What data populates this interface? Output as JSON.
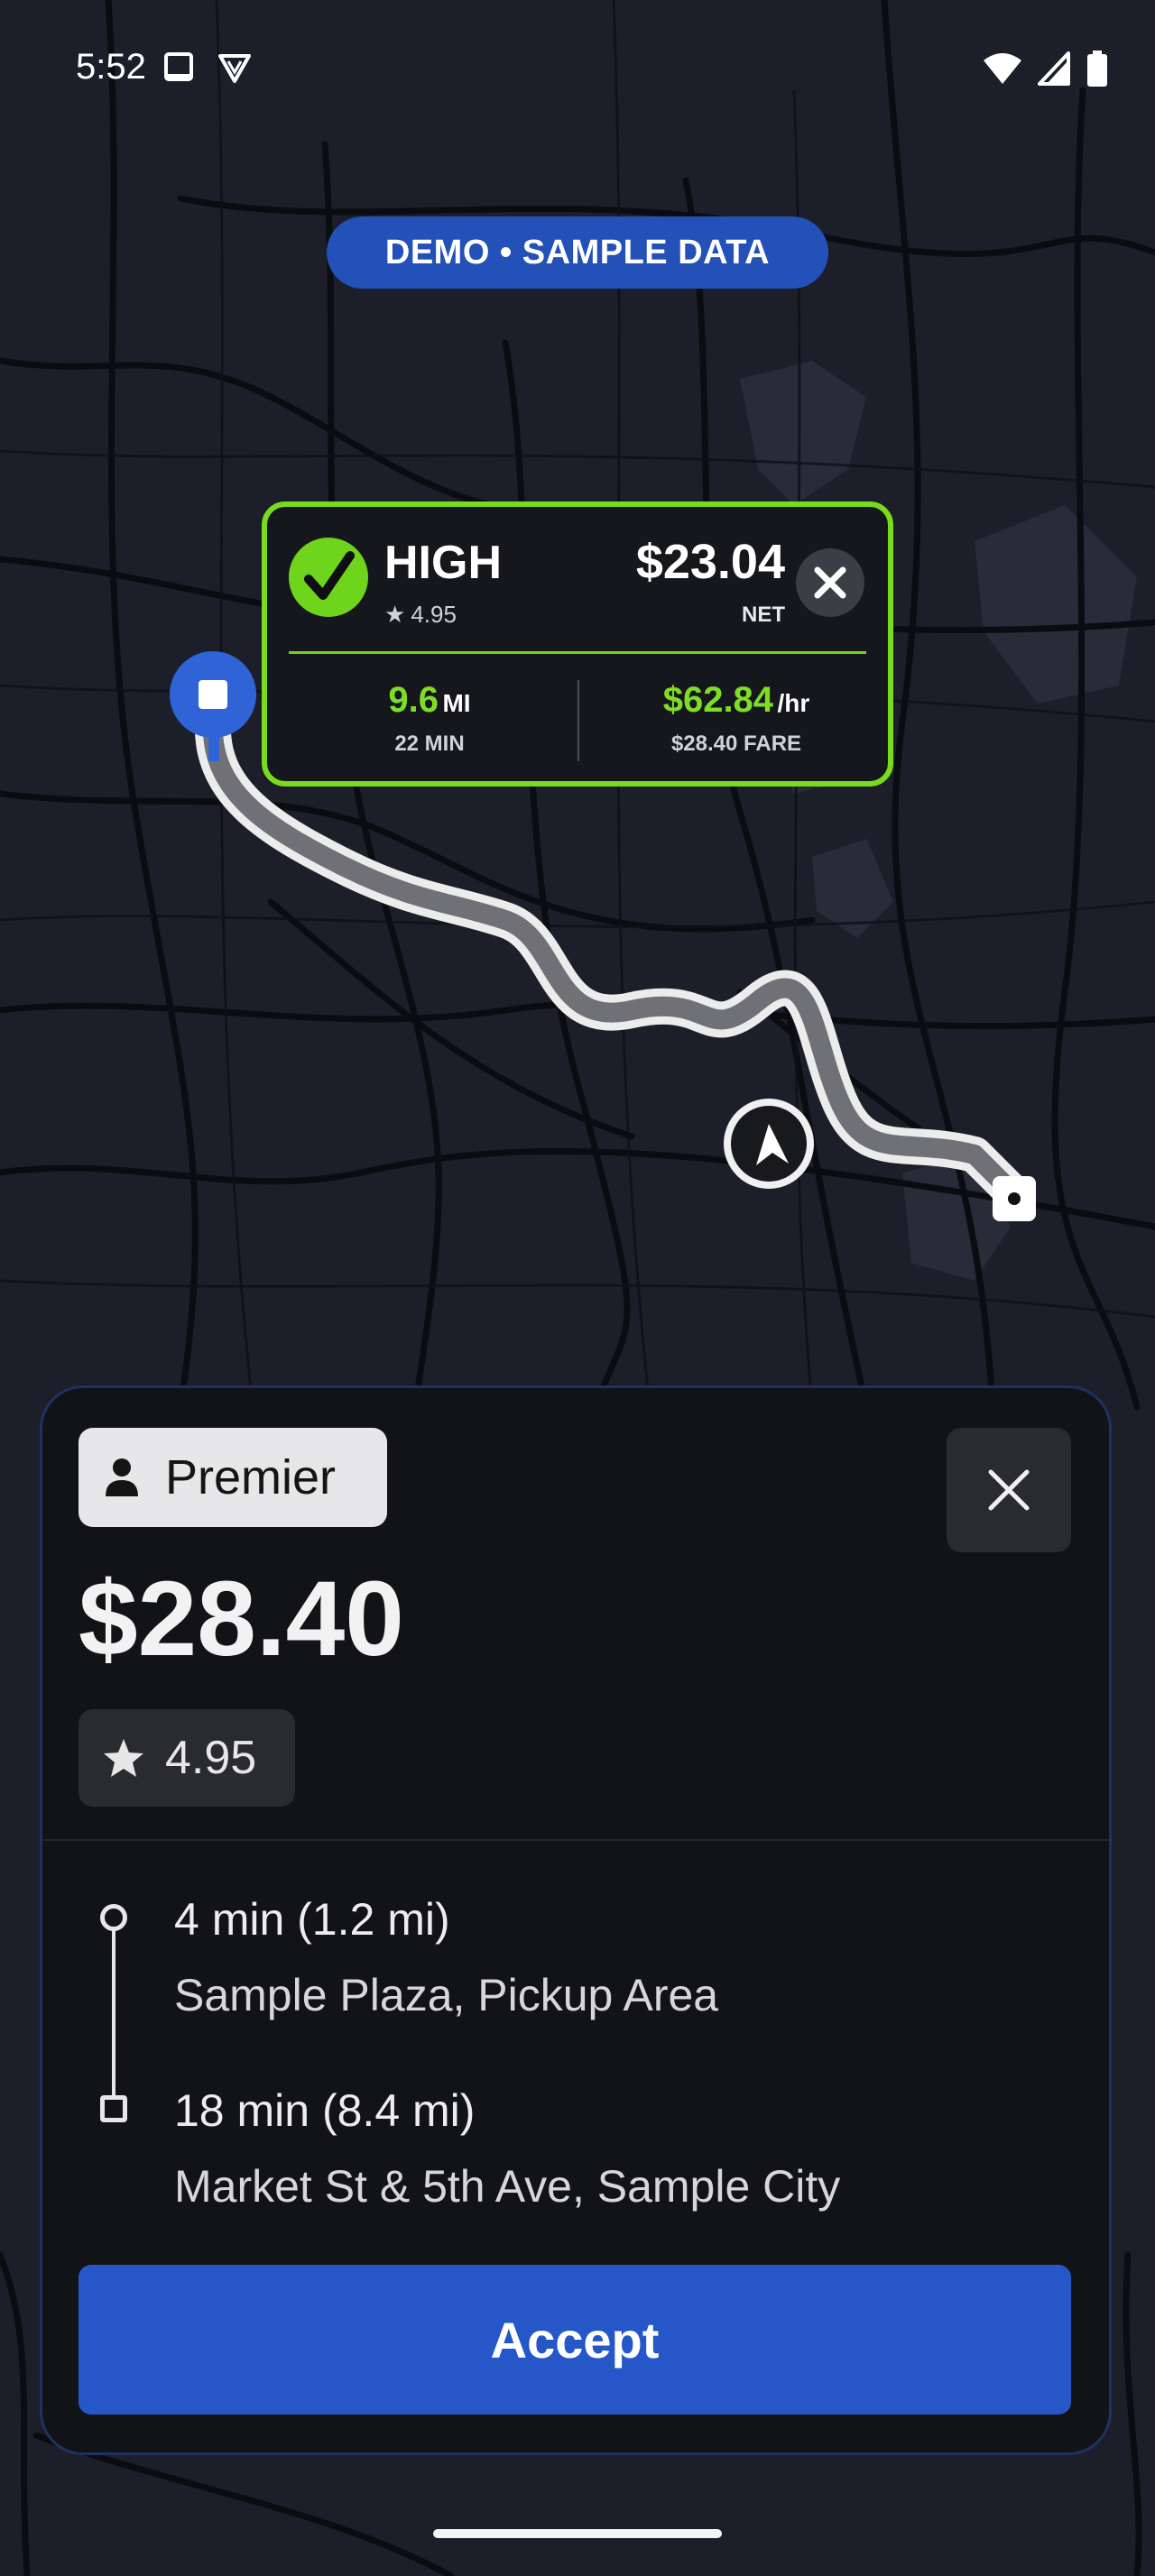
{
  "status_bar": {
    "time": "5:52",
    "left_icons": [
      "screen-icon",
      "shield-v-icon"
    ],
    "right_icons": [
      "wifi-icon",
      "signal-icon",
      "battery-icon"
    ]
  },
  "demo_badge": "DEMO • SAMPLE DATA",
  "overlay": {
    "rating_label": "HIGH",
    "rider_rating": "4.95",
    "net_amount": "$23.04",
    "net_label": "NET",
    "distance_value": "9.6",
    "distance_unit": "MI",
    "duration": "22 MIN",
    "hourly_value": "$62.84",
    "hourly_unit": "/hr",
    "fare_caption": "$28.40 FARE",
    "accent_color": "#78dc1c"
  },
  "map": {
    "pickup_pin_icon": "square-pin-icon",
    "current_location_icon": "navigation-arrow-icon",
    "dropoff_icon": "square-dot-icon"
  },
  "sheet": {
    "tier": "Premier",
    "tier_icon": "person-icon",
    "fare": "$28.40",
    "rating": "4.95",
    "pickup_eta": "4 min (1.2 mi)",
    "pickup_address": "Sample Plaza, Pickup Area",
    "dropoff_eta": "18 min (8.4 mi)",
    "dropoff_address": "Market St & 5th Ave, Sample City",
    "accept_label": "Accept",
    "accent_color": "#2557c8"
  }
}
